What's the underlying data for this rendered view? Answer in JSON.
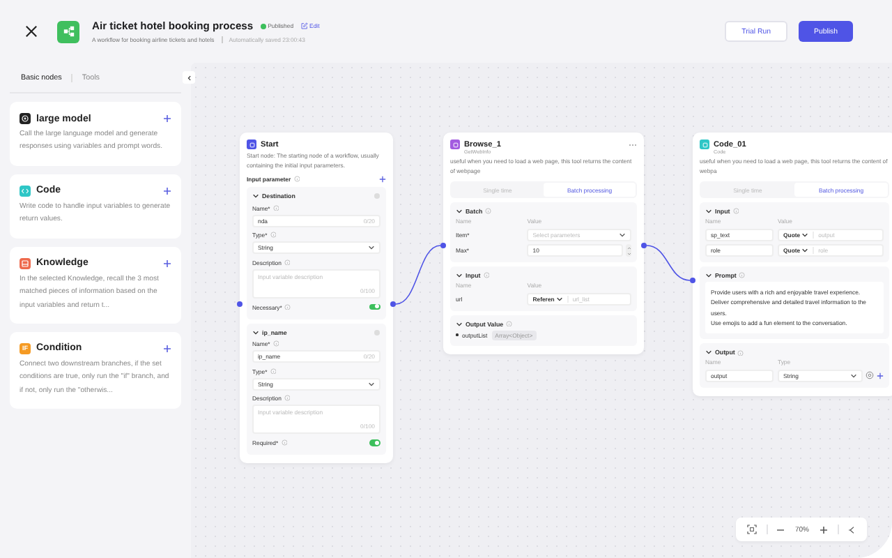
{
  "header": {
    "title": "Air ticket hotel booking process",
    "status": "Published",
    "edit": "Edit",
    "description": "A workflow for booking airline tickets and hotels",
    "saved": "Automatically saved 23:00:43",
    "buttons": [
      {
        "label": "Trial Run",
        "kind": "secondary"
      },
      {
        "label": "Publish",
        "kind": "primary"
      }
    ]
  },
  "sidebar": {
    "tabs": [
      {
        "label": "Basic nodes",
        "selected": true
      },
      {
        "label": "Tools",
        "selected": false
      }
    ],
    "items": [
      {
        "kind": "llm",
        "title": "large model",
        "description": "Call the large language model and generate responses using variables and prompt words."
      },
      {
        "kind": "code",
        "title": "Code",
        "description": "Write code to handle input variables to generate return values."
      },
      {
        "kind": "knowledge",
        "title": "Knowledge",
        "description": "In the selected Knowledge, recall the 3 most matched pieces of information based on the input variables and return t..."
      },
      {
        "kind": "condition",
        "title": "Condition",
        "icon_text": "IF",
        "description": "Connect two downstream branches, if the set conditions are true, only run the \"if\" branch, and if not, only run the \"otherwis..."
      }
    ]
  },
  "canvas": {
    "nodes": [
      {
        "kind": "start",
        "title": "Start",
        "description": "Start node: The starting node of a workflow, usually containing the initial input parameters.",
        "input_label": "Input parameter",
        "params": [
          {
            "title": "Destination",
            "name_label": "Name*",
            "name": "nda",
            "name_count": "0/20",
            "type_label": "Type*",
            "type": "String",
            "description_label": "Description",
            "description_placeholder": "Input variable description",
            "description_count": "0/100",
            "toggle_label": "Necessary*",
            "on": true
          },
          {
            "title": "ip_name",
            "name_label": "Name*",
            "name": "ip_name",
            "name_count": "0/20",
            "type_label": "Type*",
            "type": "String",
            "description_label": "Description",
            "description_placeholder": "Input variable description",
            "description_count": "0/100",
            "toggle_label": "Required*",
            "on": true
          }
        ]
      },
      {
        "kind": "tool",
        "title": "Browse_1",
        "subtitle": "GetWebInfo",
        "description": "useful when you need to load a web page, this tool returns the content of webpage",
        "tabs": [
          {
            "label": "Single time",
            "selected": false
          },
          {
            "label": "Batch processing",
            "selected": true
          }
        ],
        "sections": [
          {
            "kind": "fields",
            "title": "Batch",
            "columns": [
              "Name",
              "Value"
            ],
            "rows": [
              {
                "kind": "select",
                "name": "Item*",
                "placeholder": "Select parameters"
              },
              {
                "kind": "number",
                "name": "Max*",
                "value": "10"
              }
            ]
          },
          {
            "kind": "fields",
            "title": "Input",
            "columns": [
              "Name",
              "Value"
            ],
            "rows": [
              {
                "kind": "reference",
                "name": "url",
                "mode": "Referen",
                "value": "url_list"
              }
            ]
          },
          {
            "kind": "outputs",
            "title": "Output Value",
            "items": [
              {
                "name": "outputList",
                "type": "Array<Object>"
              }
            ]
          }
        ]
      },
      {
        "kind": "code",
        "title": "Code_01",
        "subtitle": "Code",
        "description": "useful when you need to load a web page, this tool returns the content of webpa",
        "tabs": [
          {
            "label": "Single time",
            "selected": false
          },
          {
            "label": "Batch processing",
            "selected": true
          }
        ],
        "sections": [
          {
            "kind": "fields",
            "title": "Input",
            "columns": [
              "Name",
              "Value"
            ],
            "rows": [
              {
                "kind": "named_reference",
                "name": "sp_text",
                "mode": "Quote",
                "value": "output"
              },
              {
                "kind": "named_reference",
                "name": "role",
                "mode": "Quote",
                "value": "role"
              }
            ]
          },
          {
            "kind": "prompt",
            "title": "Prompt",
            "lines": [
              "Provide users with a rich and enjoyable travel experience.",
              "Deliver comprehensive and detailed travel information to the users.",
              "Use emojis to add a fun element to the conversation."
            ]
          },
          {
            "kind": "fields",
            "title": "Output",
            "columns": [
              "Name",
              "Type"
            ],
            "rows": [
              {
                "kind": "typed_output",
                "name": "output",
                "type": "String"
              }
            ]
          }
        ]
      }
    ],
    "zoom": "70%"
  }
}
